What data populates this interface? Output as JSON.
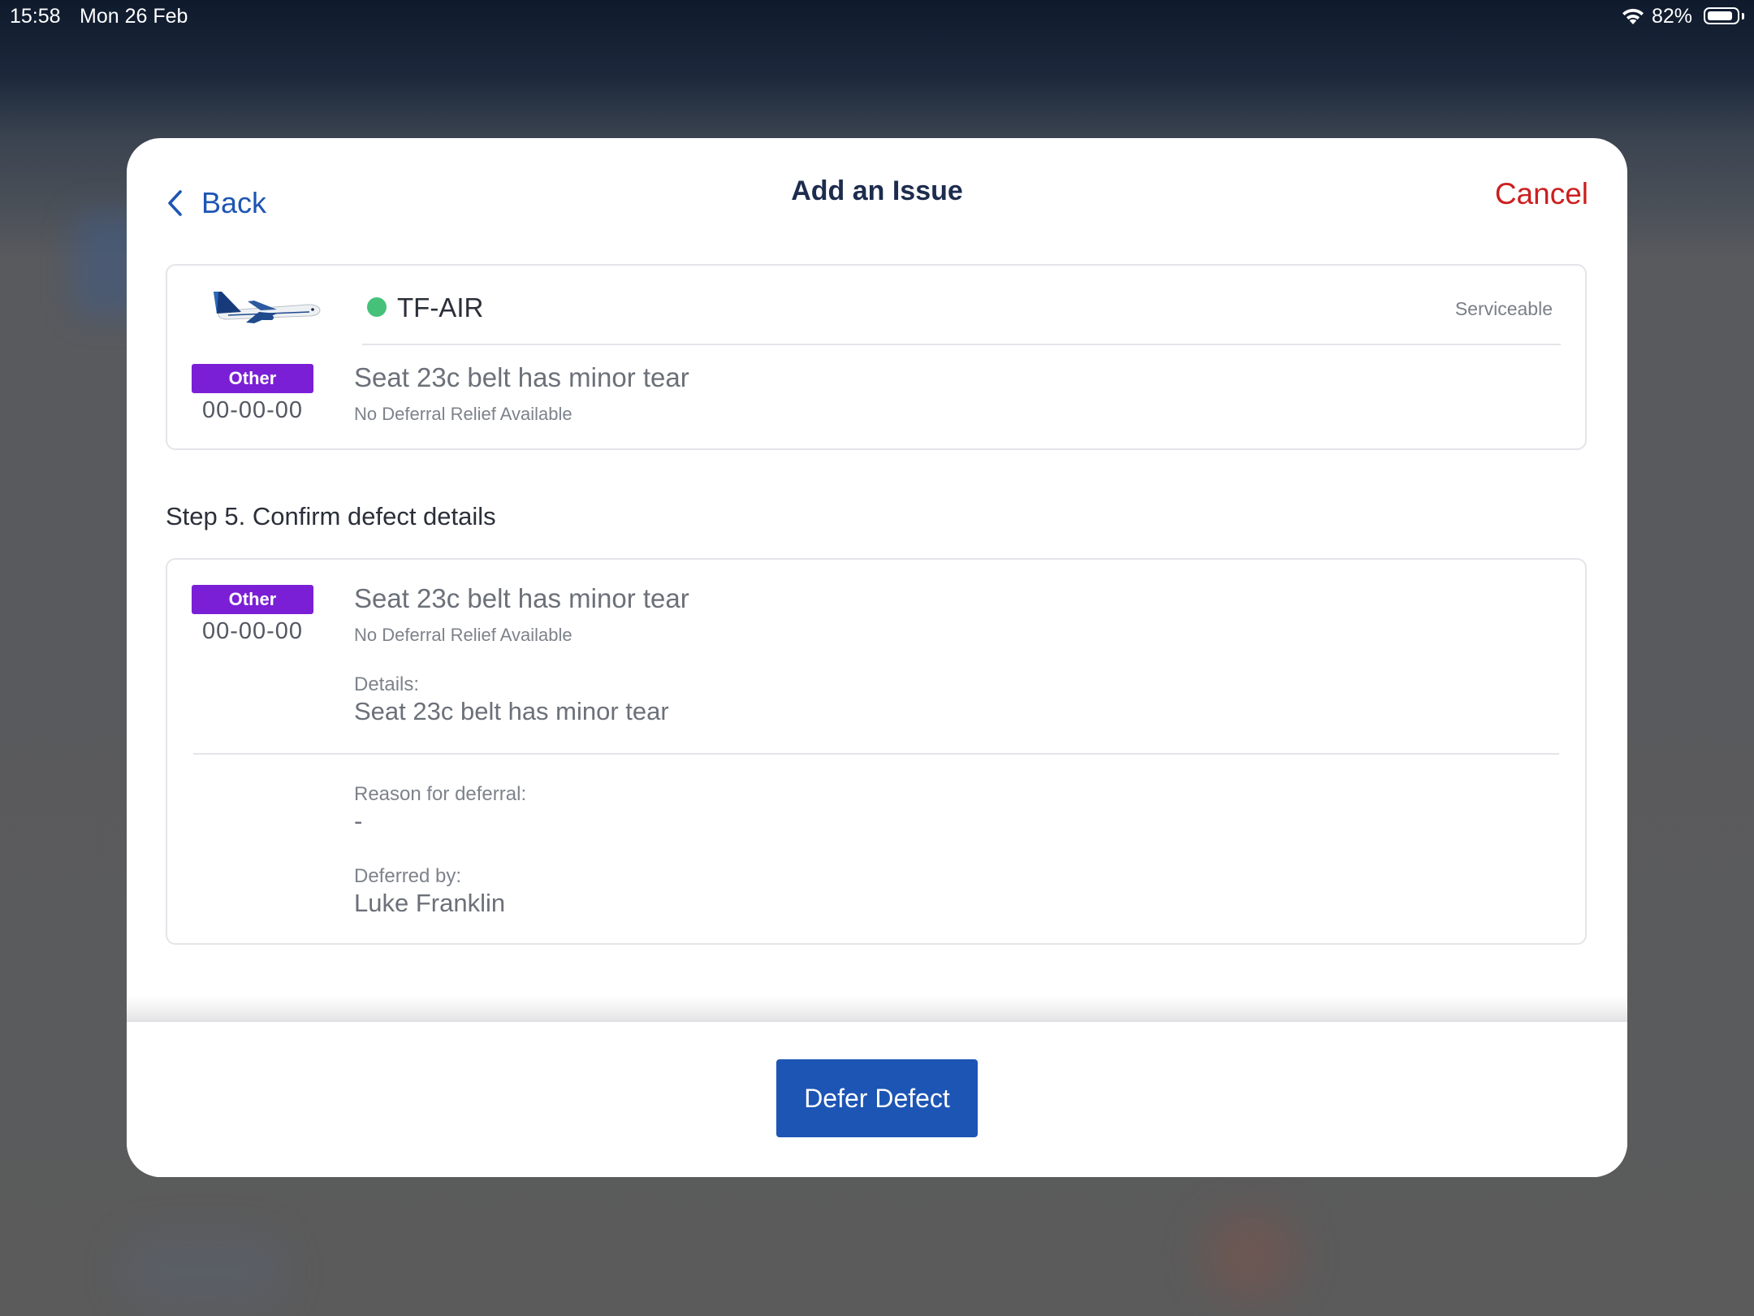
{
  "status_bar": {
    "time": "15:58",
    "date": "Mon 26 Feb",
    "battery_percent": "82%",
    "battery_level": 0.82
  },
  "nav": {
    "back_label": "Back",
    "title": "Add an Issue",
    "cancel_label": "Cancel"
  },
  "aircraft": {
    "registration": "TF-AIR",
    "status": "Serviceable",
    "status_color": "#45c17a",
    "icon": "airplane-icon"
  },
  "defect_summary": {
    "category": "Other",
    "ata_code": "00-00-00",
    "title": "Seat 23c belt has minor tear",
    "deferral_note": "No Deferral Relief Available"
  },
  "step": {
    "heading": "Step 5. Confirm defect details"
  },
  "defect_details": {
    "category": "Other",
    "ata_code": "00-00-00",
    "title": "Seat 23c belt has minor tear",
    "deferral_note": "No Deferral Relief Available",
    "details_label": "Details:",
    "details_value": "Seat 23c belt has minor tear",
    "reason_label": "Reason for deferral:",
    "reason_value": "-",
    "deferred_by_label": "Deferred by:",
    "deferred_by_value": "Luke Franklin"
  },
  "footer": {
    "primary_button": "Defer Defect"
  },
  "colors": {
    "accent": "#1d55b4",
    "cancel": "#cc1f1f",
    "category_badge": "#7a1fd6",
    "title_text": "#1d2c4e"
  }
}
